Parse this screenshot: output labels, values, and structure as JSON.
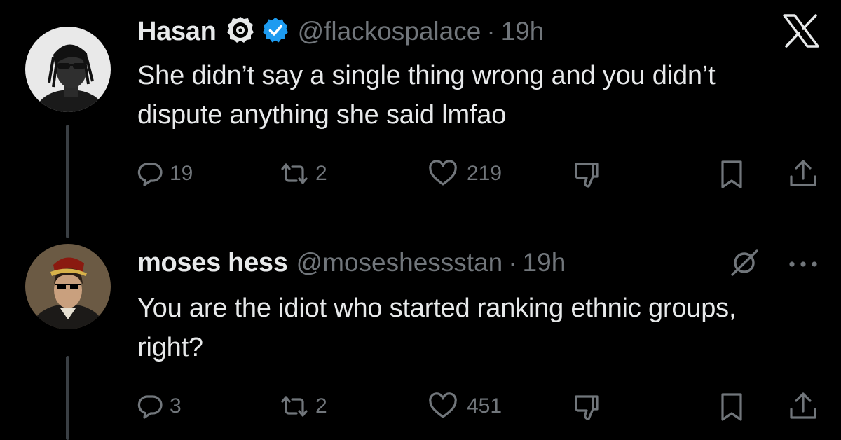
{
  "tweets": [
    {
      "name": "Hasan",
      "handle": "@flackospalace",
      "separator": "·",
      "time": "19h",
      "text": "She didn’t say a single thing wrong and you didn’t dispute anything she said lmfao",
      "actions": {
        "replies": "19",
        "reposts": "2",
        "likes": "219"
      }
    },
    {
      "name": "moses hess",
      "handle": "@moseshessstan",
      "separator": "·",
      "time": "19h",
      "text": "You are the idiot who started ranking ethnic groups, right?",
      "actions": {
        "replies": "3",
        "reposts": "2",
        "likes": "451"
      }
    }
  ],
  "icons": {
    "close": "x-logo-icon",
    "more": "more-dots-icon",
    "grok": "grok-icon",
    "verified": "verified-badge-icon",
    "affiliate": "eye-badge-icon"
  },
  "colors": {
    "background": "#000000",
    "text": "#e7e9ea",
    "muted": "#71767b",
    "verified": "#1d9bf0"
  }
}
